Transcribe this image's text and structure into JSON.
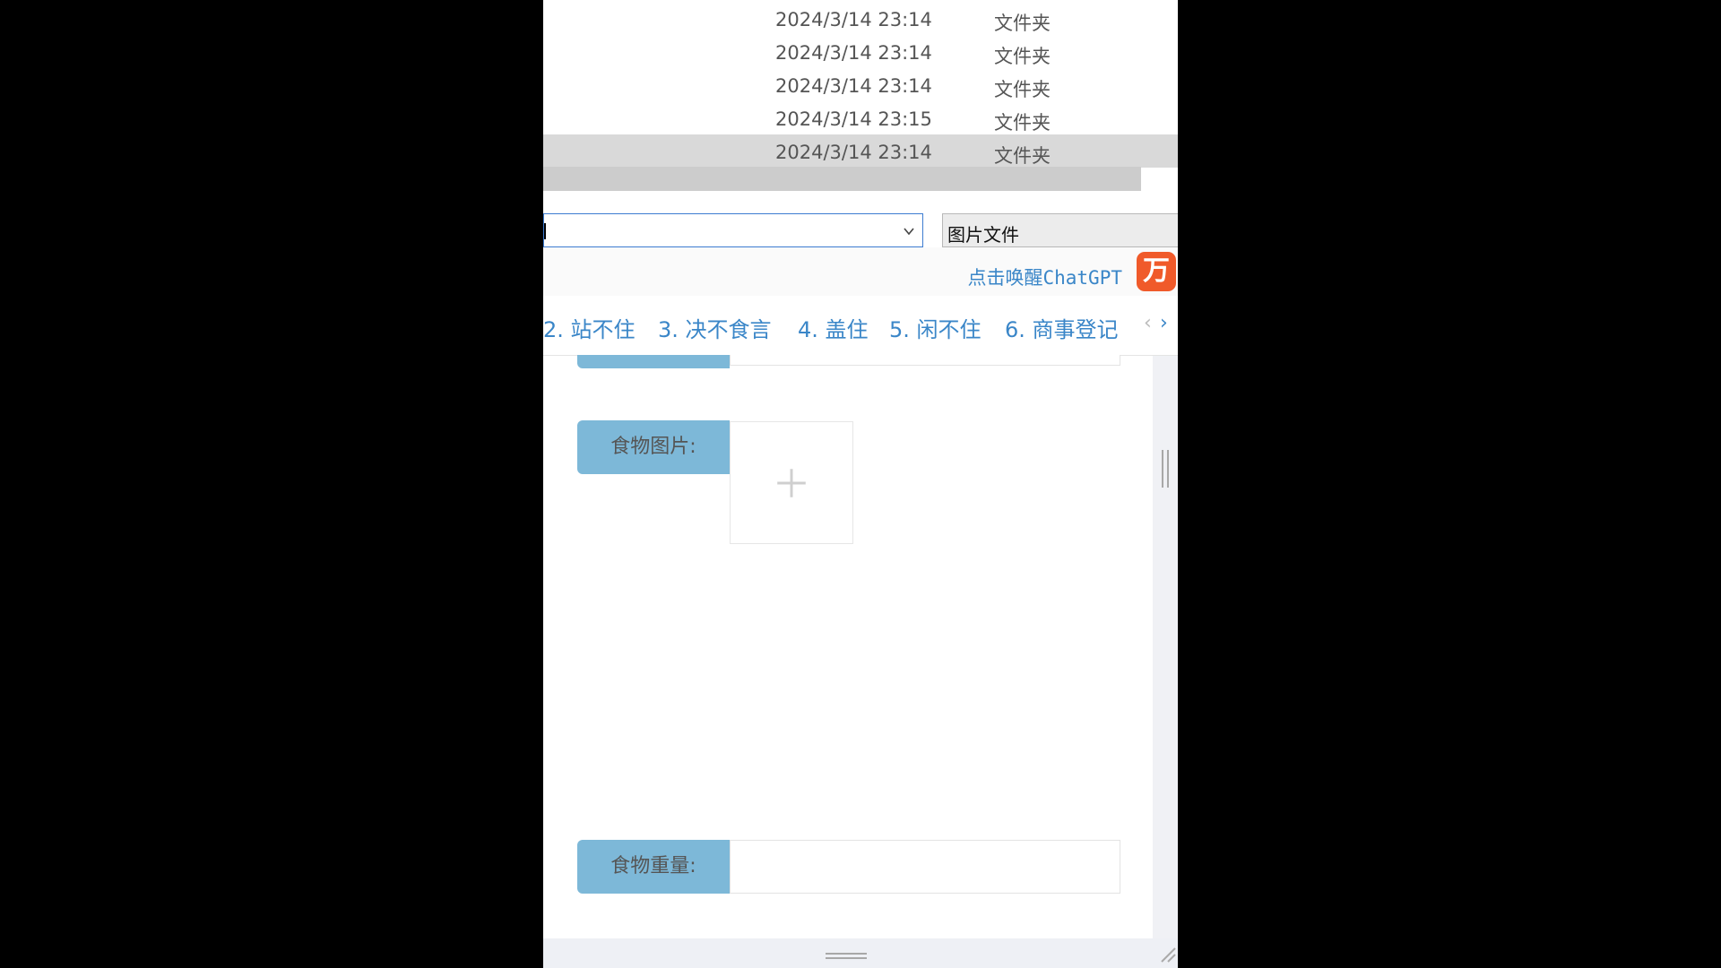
{
  "file_list": {
    "rows": [
      {
        "date": "2024/3/14 23:14",
        "type": "文件夹"
      },
      {
        "date": "2024/3/14 23:14",
        "type": "文件夹"
      },
      {
        "date": "2024/3/14 23:14",
        "type": "文件夹"
      },
      {
        "date": "2024/3/14 23:15",
        "type": "文件夹"
      },
      {
        "date": "2024/3/14 23:14",
        "type": "文件夹",
        "selected": true
      }
    ]
  },
  "dialog": {
    "filename_value": "",
    "filetype_selected": "图片文件",
    "dropdown_icon": "chevron-down-icon"
  },
  "ime": {
    "hint": "点击唤醒ChatGPT",
    "logo_glyph": "万",
    "candidates": [
      "2. 站不住",
      "3. 决不食言",
      "4. 盖住",
      "5. 闲不住",
      "6. 商事登记"
    ],
    "prev_glyph": "‹",
    "next_glyph": "›",
    "accent": "#3a86c8",
    "logo_color": "#f05a2a"
  },
  "form": {
    "image_label": "食物图片:",
    "upload_icon": "plus-icon",
    "weight_label": "食物重量:",
    "weight_value": "",
    "label_color": "#7db8d8"
  }
}
